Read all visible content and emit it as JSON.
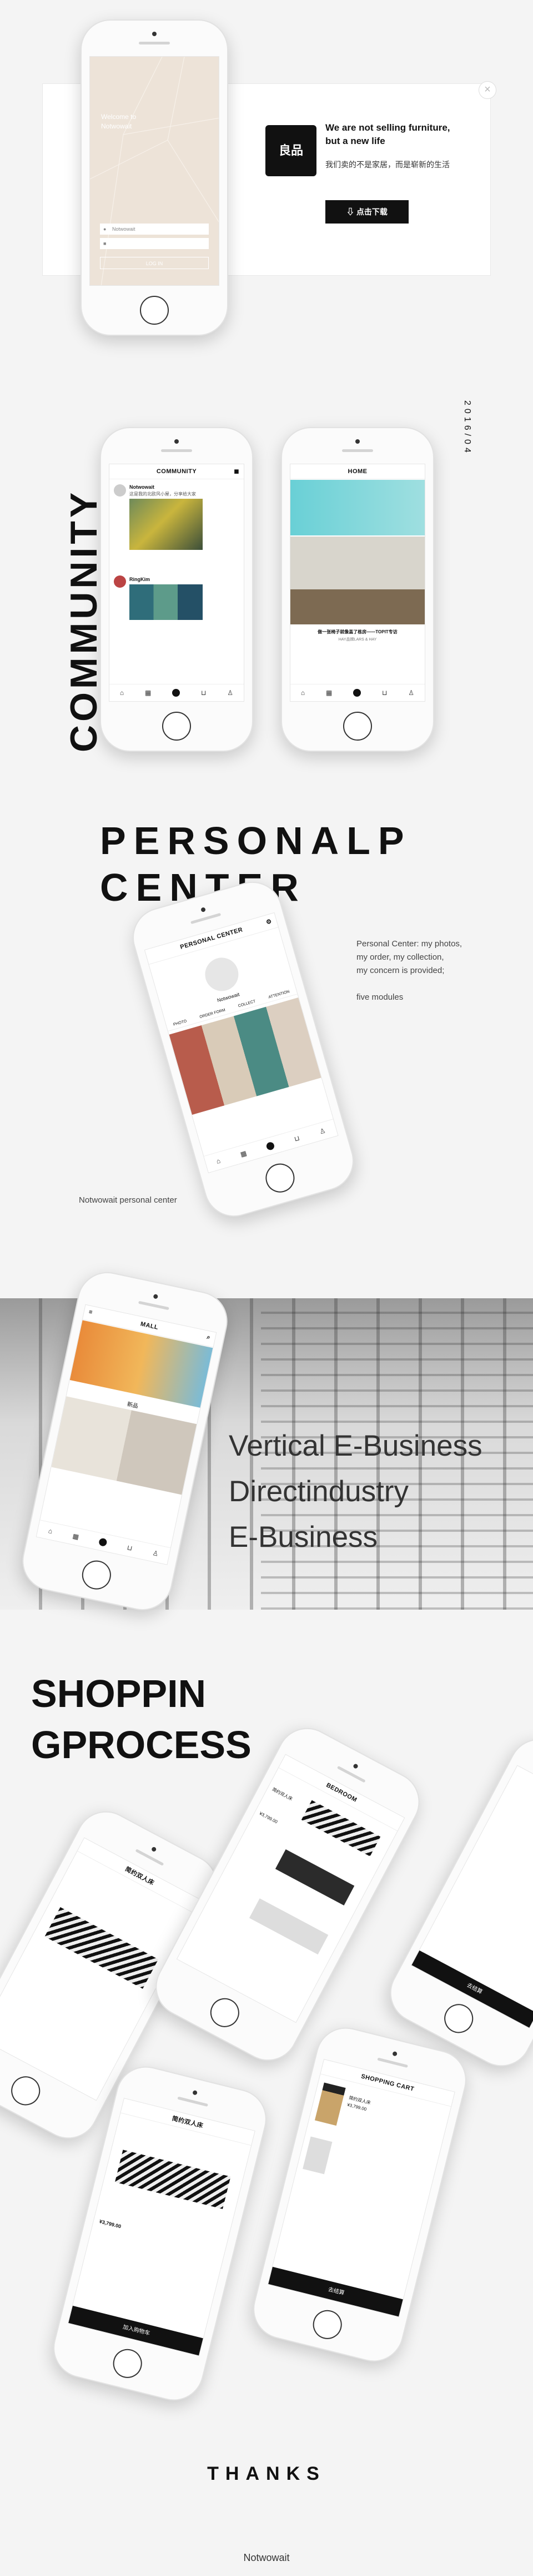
{
  "login": {
    "title_line1": "Welcome to",
    "title_line2": "Notwowait",
    "username_placeholder": "Notwowait",
    "password_placeholder": "",
    "button": "LOG IN"
  },
  "promo": {
    "headline_line1": "We are not selling furniture,",
    "headline_line2": "but a new life",
    "subline": "我们卖的不是家居，而是崭新的生活",
    "download": "点击下载",
    "close": "×"
  },
  "date": "2016/04",
  "community": {
    "vertical_title": "COMMUNITY",
    "screen_title": "COMMUNITY",
    "post_user": "Notwowait",
    "post_text": "这是我的北欧风小屋，分享给大家",
    "user2": "RingKim"
  },
  "home": {
    "screen_title": "HOME",
    "caption": "做一张椅子就像盖了栋房——TOPIT专访",
    "subcaption": "HAY品牌LARS & HAY"
  },
  "personal": {
    "title_line1": "PERSONALP",
    "title_line2": "CENTER",
    "screen_title": "PERSONAL CENTER",
    "username": "Notwowait",
    "tabs": [
      "PHOTO",
      "ORDER FORM",
      "COLLECT",
      "ATTENTION"
    ],
    "desc_line1": "Personal Center: my photos,",
    "desc_line2": "my order, my collection,",
    "desc_line3": "my concern is provided;",
    "desc_line4": "five modules",
    "caption": "Notwowait personal center"
  },
  "mall": {
    "screen_title": "MALL",
    "label": "新品",
    "line1": "Vertical E-Business",
    "line2": "Directindustry",
    "line3": "E-Business"
  },
  "shopping": {
    "title_line1": "SHOPPIN",
    "title_line2": "GPROCESS",
    "bedroom": "BEDROOM",
    "cart": "SHOPPING CART",
    "product_name": "简约双人床",
    "price": "¥3,799.00",
    "add_cart": "加入购物车",
    "checkout": "去结算"
  },
  "footer": {
    "thanks": "THANKS",
    "brand": "Notwowait"
  },
  "colors": {
    "bg": "#f4f4f4",
    "black": "#111111",
    "beige": "#ede3d8"
  }
}
